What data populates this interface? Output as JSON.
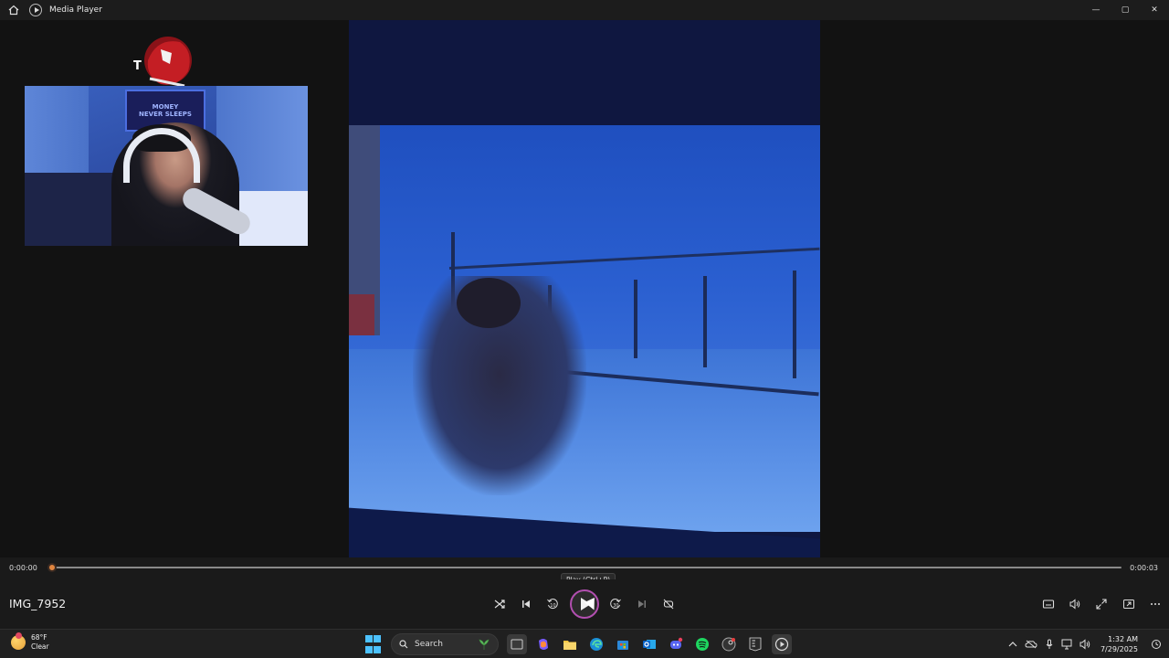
{
  "window": {
    "title": "Media Player",
    "home_icon": "home-icon",
    "app_icon": "media-player-icon",
    "minimize_glyph": "—",
    "maximize_glyph": "▢",
    "close_glyph": "✕"
  },
  "overlay": {
    "logo_letter": "T",
    "sign_line1": "MONEY",
    "sign_line2": "NEVER SLEEPS"
  },
  "player": {
    "media_title": "IMG_7952",
    "time_current": "0:00:00",
    "time_total": "0:00:03",
    "progress_fraction": 0.0,
    "tooltip": "Play (Ctrl+P)",
    "accent_color": "#e0853f",
    "play_ring_color": "#b24fb0"
  },
  "controls": {
    "shuffle_icon": "shuffle-icon",
    "previous_icon": "previous-icon",
    "skip_back_label": "10",
    "play_icon": "play-icon",
    "skip_forward_label": "30",
    "next_icon": "next-icon",
    "repeat_icon": "repeat-off-icon",
    "captions_icon": "captions-icon",
    "volume_icon": "volume-icon",
    "fullscreen_icon": "fullscreen-icon",
    "miniplayer_icon": "miniplayer-icon",
    "more_icon": "more-icon"
  },
  "taskbar": {
    "weather_temp": "68°F",
    "weather_condition": "Clear",
    "search_label": "Search",
    "time": "1:32 AM",
    "date": "7/29/2025"
  }
}
